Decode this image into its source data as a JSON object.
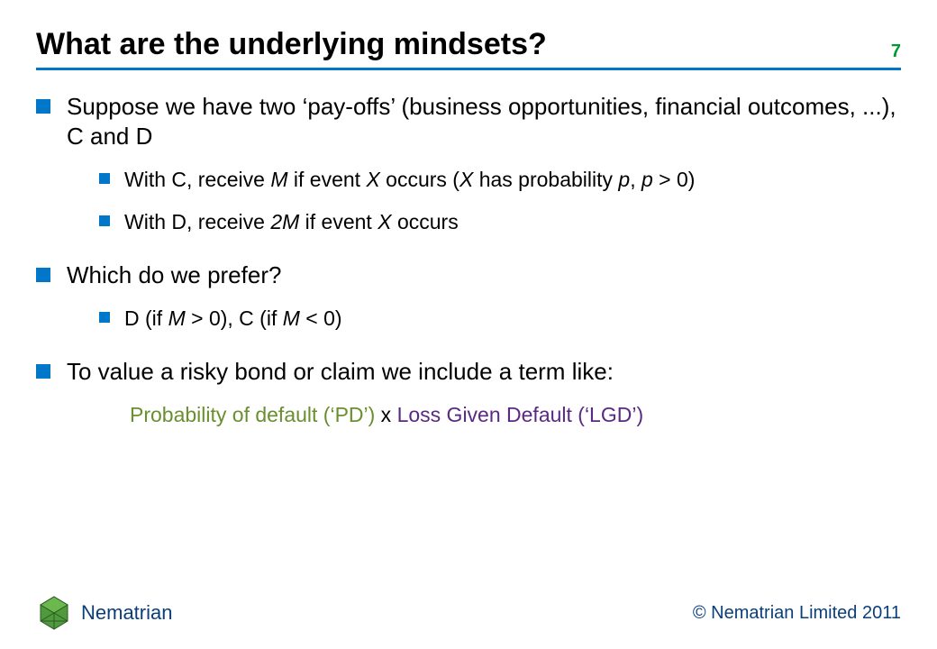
{
  "page_number": "7",
  "title": "What are the underlying mindsets?",
  "bullets": {
    "b1": "Suppose we have two ‘pay-offs’ (business opportunities, financial outcomes, ...), C and D",
    "b1_sub1_pre": "With C, receive ",
    "b1_sub1_M": "M",
    "b1_sub1_mid1": " if event ",
    "b1_sub1_X1": "X",
    "b1_sub1_mid2": " occurs (",
    "b1_sub1_X2": "X",
    "b1_sub1_mid3": " has probability ",
    "b1_sub1_p1": "p",
    "b1_sub1_mid4": ", ",
    "b1_sub1_p2": "p",
    "b1_sub1_tail": " > 0)",
    "b1_sub2_pre": "With D, receive ",
    "b1_sub2_2M": "2M",
    "b1_sub2_mid": " if event ",
    "b1_sub2_X": "X",
    "b1_sub2_tail": " occurs",
    "b2": "Which do we prefer?",
    "b2_sub1_pre": "D (if ",
    "b2_sub1_M1": "M",
    "b2_sub1_mid": " > 0), C (if ",
    "b2_sub1_M2": "M",
    "b2_sub1_tail": " < 0)",
    "b3": "To value a risky bond or claim we include a term like:"
  },
  "formula": {
    "part1": "Probability of default (‘PD’)",
    "sep": " x ",
    "part2": "Loss Given Default (‘LGD’)"
  },
  "brand": {
    "name": "Nematrian",
    "copyright": "© Nematrian Limited 2011"
  }
}
